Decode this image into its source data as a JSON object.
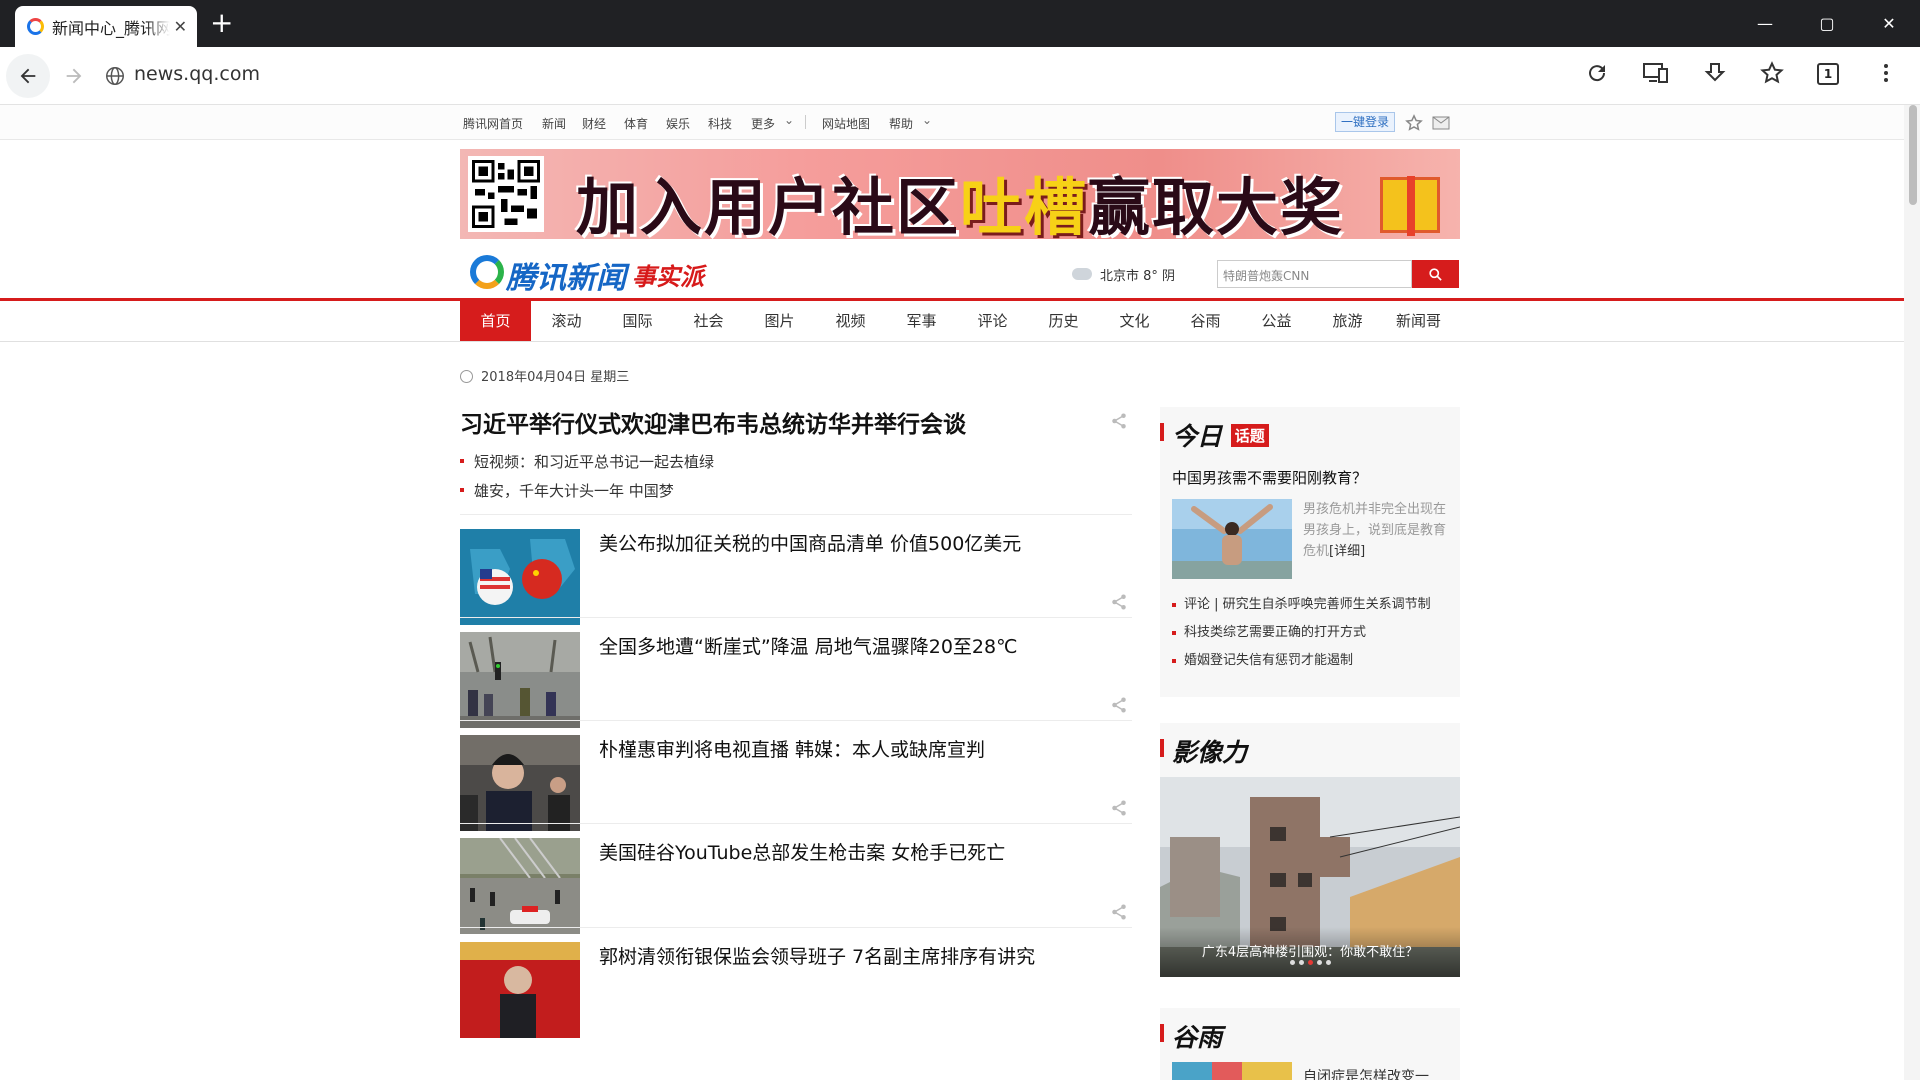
{
  "browser": {
    "tab_title": "新闻中心_腾讯网",
    "tab_close": "✕",
    "new_tab": "+",
    "window_minimize": "—",
    "window_maximize": "▢",
    "window_close": "✕",
    "url": "news.qq.com",
    "tab_count": "1"
  },
  "topnav": {
    "items": [
      "腾讯网首页",
      "新闻",
      "财经",
      "体育",
      "娱乐",
      "科技",
      "更多",
      "网站地图",
      "帮助"
    ],
    "login": "一键登录"
  },
  "banner": {
    "text_a": "加入用户社区",
    "text_b": "吐",
    "text_c": "槽",
    "text_d": "赢取大奖"
  },
  "header": {
    "logo": "腾讯新闻",
    "logo_sub": "事实派",
    "weather": "北京市  8°  阴",
    "search_placeholder": "特朗普炮轰CNN"
  },
  "mainnav": {
    "items": [
      "首页",
      "滚动",
      "国际",
      "社会",
      "图片",
      "视频",
      "军事",
      "评论",
      "历史",
      "文化",
      "谷雨",
      "公益",
      "旅游",
      "新闻哥"
    ],
    "active_index": 0
  },
  "date": "2018年04月04日    星期三",
  "lead": {
    "title": "习近平举行仪式欢迎津巴布韦总统访华并举行会谈",
    "subs": [
      "短视频：和习近平总书记一起去植绿",
      "雄安，千年大计头一年 中国梦"
    ]
  },
  "news": [
    {
      "title": "美公布拟加征关税的中国商品清单 价值500亿美元"
    },
    {
      "title": "全国多地遭“断崖式”降温 局地气温骤降20至28℃"
    },
    {
      "title": "朴槿惠审判将电视直播 韩媒：本人或缺席宣判"
    },
    {
      "title": "美国硅谷YouTube总部发生枪击案 女枪手已死亡"
    },
    {
      "title": "郭树清领衔银保监会领导班子 7名副主席排序有讲究"
    }
  ],
  "today_topic": {
    "head": "今日",
    "tag": "话题",
    "question": "中国男孩需不需要阳刚教育？",
    "desc": "男孩危机并非完全出现在男孩身上，说到底是教育危机",
    "more": "[详细]",
    "links": [
      "评论 | 研究生自杀呼唤完善师生关系调节制",
      "科技类综艺需要正确的打开方式",
      "婚姻登记失信有惩罚才能遏制"
    ]
  },
  "image_power": {
    "head": "影像力",
    "caption": "广东4层高神楼引围观：你敢不敢住？",
    "dots_total": 5,
    "dots_active": 2
  },
  "guyu": {
    "head": "谷雨",
    "title": "自闭症是怎样改变一"
  },
  "colors": {
    "brand_red": "#d61c1c",
    "brand_blue": "#1566c5",
    "chrome_dark": "#202124"
  }
}
